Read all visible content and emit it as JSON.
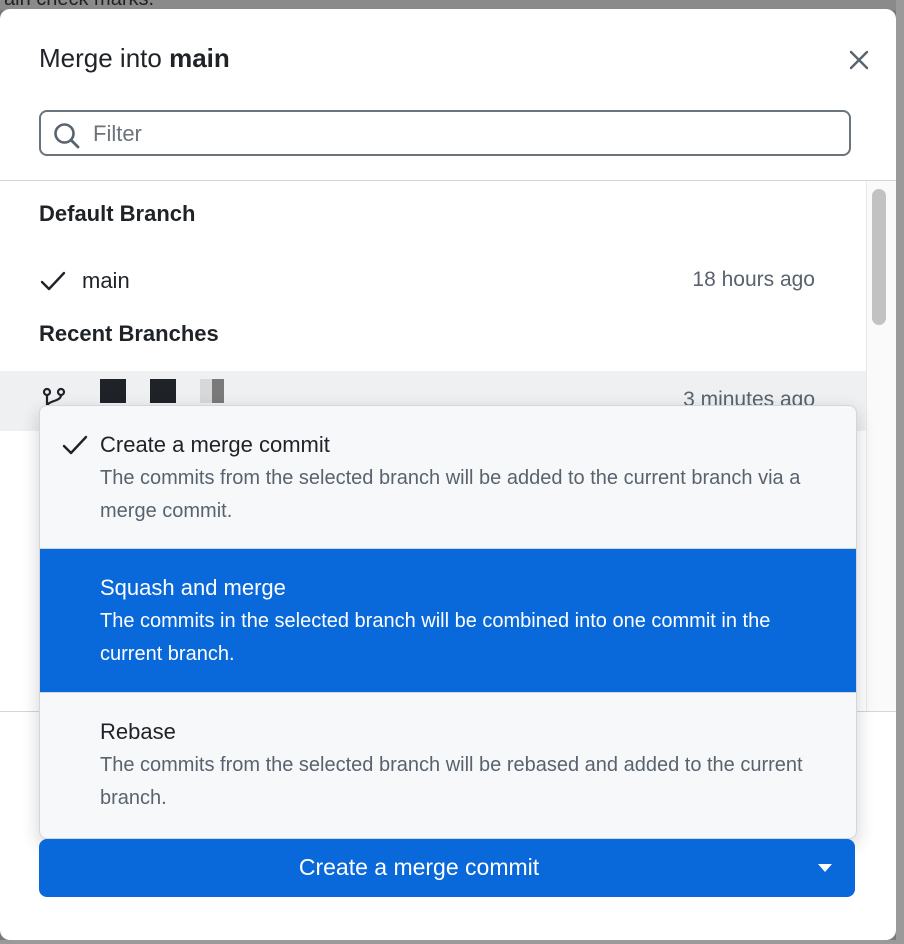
{
  "background": {
    "partial_text": "ain check marks."
  },
  "dialog": {
    "title_prefix": "Merge into ",
    "title_branch": "main",
    "close_icon": "close-icon",
    "filter": {
      "placeholder": "Filter",
      "value": ""
    }
  },
  "sections": {
    "default_heading": "Default Branch",
    "recent_heading": "Recent Branches"
  },
  "branches": {
    "default": {
      "name": "main",
      "time": "18 hours ago",
      "selected": true
    },
    "recent": {
      "time": "3 minutes ago",
      "name_redacted": true
    }
  },
  "merge_options": [
    {
      "title": "Create a merge commit",
      "description": "The commits from the selected branch will be added to the current branch via a merge commit.",
      "checked": true
    },
    {
      "title": "Squash and merge",
      "description": "The commits in the selected branch will be combined into one commit in the current branch.",
      "highlighted": true
    },
    {
      "title": "Rebase",
      "description": "The commits from the selected branch will be rebased and added to the current branch."
    }
  ],
  "primary_button": {
    "label": "Create a merge commit"
  },
  "colors": {
    "accent": "#0969da",
    "text": "#1f2328",
    "muted": "#59636e",
    "border": "#d0d7de",
    "hover_row": "#eef0f2"
  }
}
